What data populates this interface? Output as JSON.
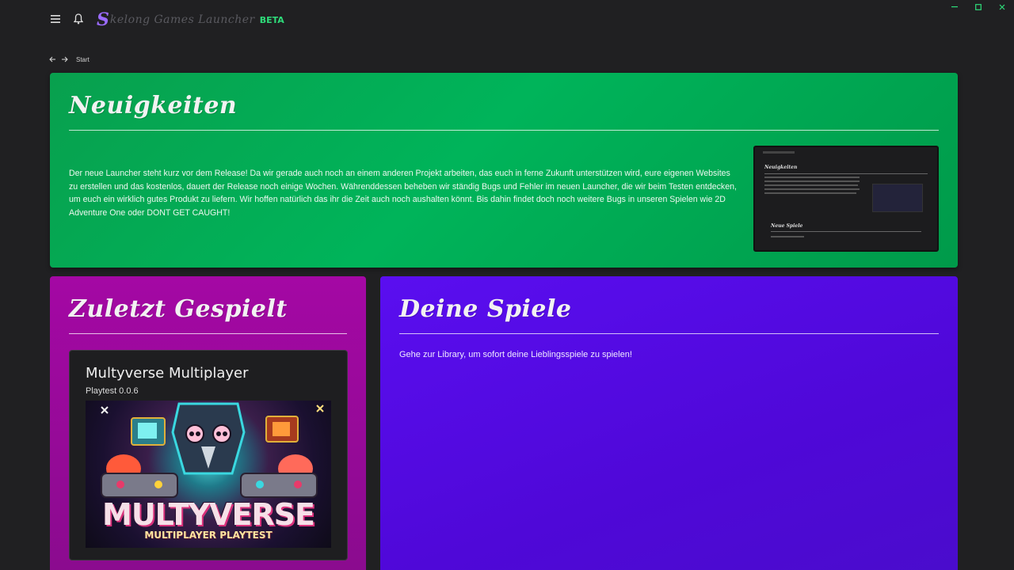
{
  "app": {
    "logo_initial": "S",
    "logo_name": "kelong Games Launcher",
    "logo_badge": "BETA",
    "accent": "#9b6bff",
    "badge_color": "#2edc7a"
  },
  "titlebar": {
    "icons": [
      "menu-icon",
      "bell-icon"
    ],
    "window_controls": [
      "minimize-icon",
      "maximize-icon",
      "close-icon"
    ]
  },
  "breadcrumb": {
    "label": "Start"
  },
  "news": {
    "title": "Neuigkeiten",
    "text": "Der neue Launcher steht kurz vor dem Release! Da wir gerade auch noch an einem anderen Projekt arbeiten, das euch in ferne Zukunft unterstützen wird, eure eigenen Websites zu erstellen und das kostenlos, dauert der Release noch einige Wochen. Währenddessen beheben wir ständig Bugs und Fehler im neuen Launcher, die wir beim Testen entdecken, um euch ein wirklich gutes Produkt zu liefern. Wir hoffen natürlich das ihr die Zeit auch noch aushalten könnt. Bis dahin findet doch noch weitere Bugs in unseren Spielen wie 2D Adventure One oder DONT GET CAUGHT!",
    "preview": {
      "title": "Neuigkeiten",
      "title2": "Neue Spiele"
    },
    "color": "#00a84f"
  },
  "recent": {
    "title": "Zuletzt Gespielt",
    "game": {
      "title": "Multyverse Multiplayer",
      "version": "Playtest 0.0.6",
      "art_title": "MULTYVERSE",
      "art_subtitle": "MULTIPLAYER PLAYTEST"
    },
    "color": "#a00aa0"
  },
  "games": {
    "title": "Deine Spiele",
    "text": "Gehe zur Library, um sofort deine Lieblingsspiele zu spielen!",
    "color": "#560de6"
  }
}
